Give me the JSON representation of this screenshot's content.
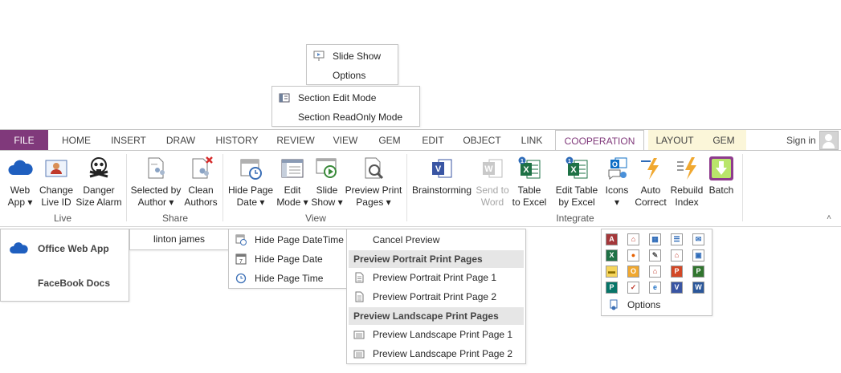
{
  "slide_menu": {
    "items": [
      "Slide Show",
      "Options"
    ]
  },
  "section_menu": {
    "items": [
      "Section Edit Mode",
      "Section ReadOnly Mode"
    ]
  },
  "tabs": [
    {
      "label": "FILE"
    },
    {
      "label": "HOME"
    },
    {
      "label": "INSERT"
    },
    {
      "label": "DRAW"
    },
    {
      "label": "HISTORY"
    },
    {
      "label": "REVIEW"
    },
    {
      "label": "VIEW"
    },
    {
      "label": "GEM"
    },
    {
      "label": "EDIT"
    },
    {
      "label": "OBJECT"
    },
    {
      "label": "LINK"
    },
    {
      "label": "COOPERATION"
    },
    {
      "label": "LAYOUT"
    },
    {
      "label": "GEM"
    }
  ],
  "sign_in": "Sign in",
  "groups": {
    "live": "Live",
    "share": "Share",
    "view": "View",
    "integrate": "Integrate"
  },
  "buttons": {
    "web_app": [
      "Web",
      "App ▾"
    ],
    "change_live_id": [
      "Change",
      "Live ID"
    ],
    "danger_size_alarm": [
      "Danger",
      "Size Alarm"
    ],
    "selected_by_author": [
      "Selected by",
      "Author ▾"
    ],
    "clean_authors": [
      "Clean",
      "Authors"
    ],
    "hide_page_date": [
      "Hide Page",
      "Date ▾"
    ],
    "edit_mode": [
      "Edit",
      "Mode ▾"
    ],
    "slide_show": [
      "Slide",
      "Show ▾"
    ],
    "preview_print_pages": [
      "Preview Print",
      "Pages ▾"
    ],
    "brainstorming": [
      "Brainstorming"
    ],
    "send_to_word": [
      "Send to",
      "Word"
    ],
    "table_to_excel": [
      "Table",
      "to Excel"
    ],
    "edit_table_by_excel": [
      "Edit Table",
      "by Excel"
    ],
    "icons": [
      "Icons",
      "▾"
    ],
    "auto_correct": [
      "Auto",
      "Correct"
    ],
    "rebuild_index": [
      "Rebuild",
      "Index"
    ],
    "batch": [
      "Batch"
    ]
  },
  "webapp_menu": {
    "items": [
      "Office Web App",
      "FaceBook Docs"
    ]
  },
  "author_menu": {
    "items": [
      "linton james"
    ]
  },
  "hide_date_menu": {
    "items": [
      "Hide Page DateTime",
      "Hide Page Date",
      "Hide Page Time"
    ]
  },
  "preview_menu": {
    "cancel": "Cancel Preview",
    "portrait_header": "Preview Portrait Print Pages",
    "portrait_items": [
      "Preview Portrait Print Page 1",
      "Preview Portrait Print Page 2"
    ],
    "landscape_header": "Preview Landscape Print Pages",
    "landscape_items": [
      "Preview Landscape Print Page 1",
      "Preview Landscape Print Page 2"
    ]
  },
  "icons_menu": {
    "grid": [
      "access",
      "pdf",
      "calendar",
      "contact-card",
      "envelope",
      "excel",
      "firefox",
      "document-pen",
      "pdf-doc",
      "contact-grid",
      "note",
      "outlook",
      "pdf-alt",
      "powerpoint",
      "project",
      "publisher",
      "document-check",
      "ie",
      "visio",
      "word"
    ],
    "options": "Options"
  },
  "colors": {
    "file_tab": "#80397b",
    "coop_tab": "#80397b",
    "context_tab_bg": "#fbf6d9",
    "batch_bg": "#8e3b8d"
  }
}
